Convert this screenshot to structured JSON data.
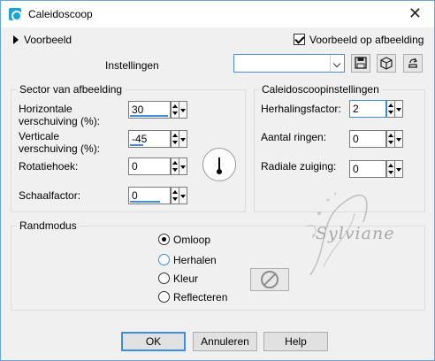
{
  "window": {
    "title": "Caleidoscoop",
    "close_glyph": "✕"
  },
  "top": {
    "preview_toggle_label": "Voorbeeld",
    "preview_on_image_label": "Voorbeeld op afbeelding",
    "preview_on_image_checked": true,
    "settings_label": "Instellingen",
    "settings_value": ""
  },
  "sector": {
    "title": "Sector van afbeelding",
    "h_offset_label_1": "Horizontale",
    "h_offset_label_2": "verschuiving (%):",
    "h_offset_value": "30",
    "v_offset_label_1": "Verticale",
    "v_offset_label_2": "verschuiving (%):",
    "v_offset_value": "-45",
    "rotation_label": "Rotatiehoek:",
    "rotation_value": "0",
    "scale_label": "Schaalfactor:",
    "scale_value": "0"
  },
  "kaleido": {
    "title": "Caleidoscoopinstellingen",
    "repeat_label": "Herhalingsfactor:",
    "repeat_value": "2",
    "rings_label": "Aantal ringen:",
    "rings_value": "0",
    "radial_label": "Radiale zuiging:",
    "radial_value": "0"
  },
  "edge": {
    "title": "Randmodus",
    "options": [
      "Omloop",
      "Herhalen",
      "Kleur",
      "Reflecteren"
    ],
    "selected": "Omloop"
  },
  "watermark_text": "Sylviane",
  "buttons": {
    "ok": "OK",
    "cancel": "Annuleren",
    "help": "Help"
  },
  "icons": {
    "app": "kaleidoscope-icon",
    "save": "save-icon",
    "presets": "cube-icon",
    "reset": "reset-icon",
    "no_color": "no-color-icon"
  }
}
